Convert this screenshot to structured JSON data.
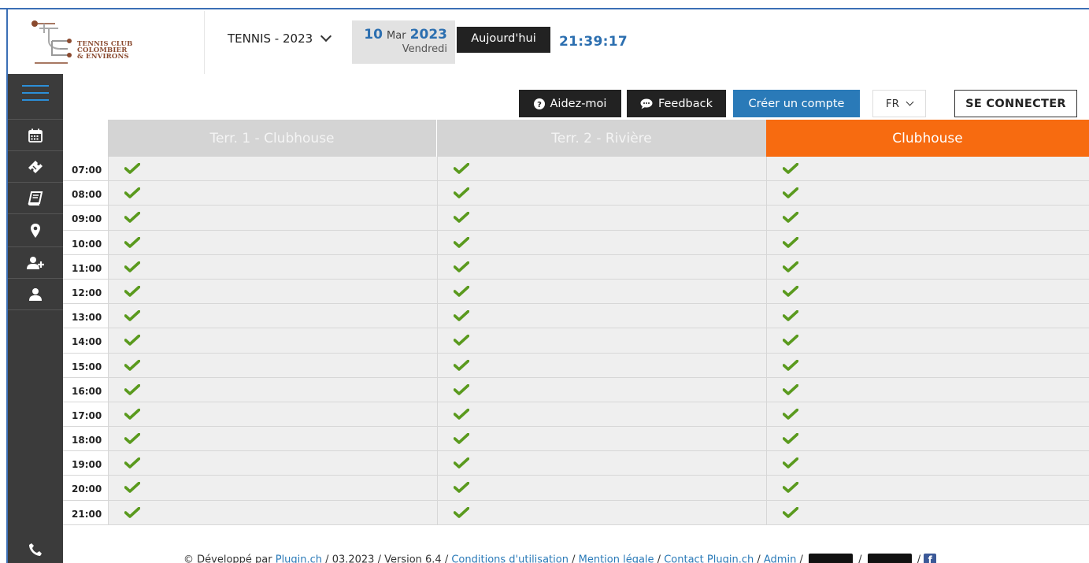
{
  "header": {
    "logo_lines": [
      "TENNIS CLUB",
      "COLOMBIER",
      "& ENVIRONS"
    ],
    "season": "TENNIS - 2023",
    "date": {
      "day": "10",
      "month": "Mar",
      "year": "2023",
      "weekday": "Vendredi"
    },
    "today_label": "Aujourd'hui",
    "clock": "21:39:17"
  },
  "actions": {
    "help_label": "Aidez-moi",
    "feedback_label": "Feedback",
    "create_account_label": "Créer un compte",
    "language": "FR",
    "login_label": "SE CONNECTER"
  },
  "sidebar": {
    "icons": [
      "menu-icon",
      "calendar-icon",
      "ticket-icon",
      "book-icon",
      "map-pin-icon",
      "user-plus-icon",
      "user-icon",
      "phone-icon"
    ]
  },
  "grid": {
    "columns": [
      {
        "name": "Terr. 1 - Clubhouse",
        "active": false
      },
      {
        "name": "Terr. 2 - Rivière",
        "active": false
      },
      {
        "name": "Clubhouse",
        "active": true
      }
    ],
    "times": [
      "07:00",
      "08:00",
      "09:00",
      "10:00",
      "11:00",
      "12:00",
      "13:00",
      "14:00",
      "15:00",
      "16:00",
      "17:00",
      "18:00",
      "19:00",
      "20:00",
      "21:00"
    ],
    "availability": "available"
  },
  "footer": {
    "prefix": "© Développé par ",
    "dev_link": "Plugin.ch",
    "mid": " / 03.2023 / Version 6.4 / ",
    "terms": "Conditions d'utilisation",
    "sep": " / ",
    "legal": "Mention légale",
    "contact": "Contact Plugin.ch",
    "admin": "Admin",
    "fb_letter": "f"
  },
  "colors": {
    "accent_blue": "#2a7ab8",
    "active_column": "#f76b10",
    "available_check": "#5a9a1e",
    "sidebar_bg": "#3b3b3b"
  }
}
